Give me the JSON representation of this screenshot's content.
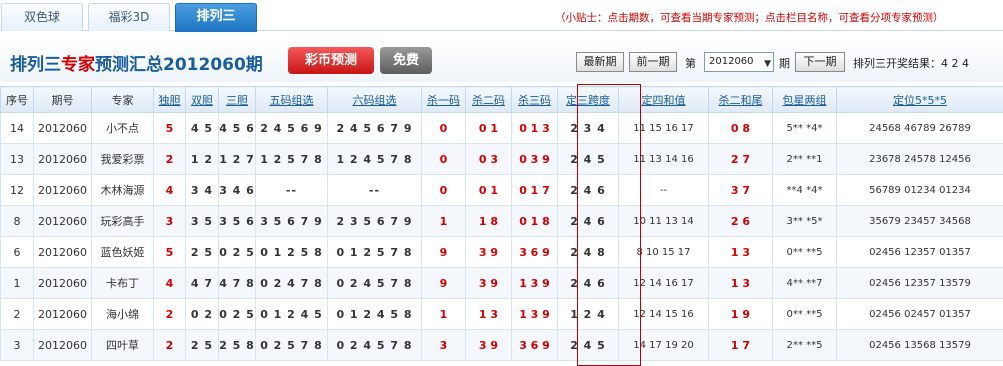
{
  "tabs": [
    {
      "label": "双色球"
    },
    {
      "label": "福彩3D"
    },
    {
      "label": "排列三"
    }
  ],
  "tip": "（小贴士：点击期数，可查看当期专家预测；点击栏目名称，可查看分项专家预测）",
  "header": {
    "title_a": "排列三",
    "title_b": "专家",
    "title_c": "预测汇总2012060期",
    "btn_predict": "彩币预测",
    "btn_free": "免费",
    "btn_latest": "最新期",
    "btn_prev": "前一期",
    "label_di": "第",
    "issue_value": "2012060",
    "label_qi": "期",
    "btn_next": "下一期",
    "result_label": "排列三开奖结果：",
    "result_value": "4 2 4"
  },
  "columns": [
    "序号",
    "期号",
    "专家",
    "独胆",
    "双胆",
    "三胆",
    "五码组选",
    "六码组选",
    "杀一码",
    "杀二码",
    "杀三码",
    "定三跨度",
    "定四和值",
    "杀二和尾",
    "包星两组",
    "定位5*5*5"
  ],
  "rows": [
    {
      "seq": "14",
      "issue": "2012060",
      "expert": "小不点",
      "c1": "5",
      "c2": "4 5",
      "c3": "4 5 6",
      "c4": "2 4 5 6 9",
      "c5": "2 4 5 6 7 9",
      "k1": "0",
      "k2": "0 1",
      "k3": "0 1 3",
      "span": "2 3 4",
      "sum4": "11 15 16 17",
      "kill2tail": "0 8",
      "star": "5** *4*",
      "pos": "24568 46789 26789"
    },
    {
      "seq": "13",
      "issue": "2012060",
      "expert": "我爱彩票",
      "c1": "2",
      "c2": "1 2",
      "c3": "1 2 7",
      "c4": "1 2 5 7 8",
      "c5": "1 2 4 5 7 8",
      "k1": "0",
      "k2": "0 3",
      "k3": "0 3 9",
      "span": "2 4 5",
      "sum4": "11 13 14 16",
      "kill2tail": "2 7",
      "star": "2** **1",
      "pos": "23678 24578 12456"
    },
    {
      "seq": "12",
      "issue": "2012060",
      "expert": "木林海源",
      "c1": "4",
      "c2": "3 4",
      "c3": "3 4 6",
      "c4": "--",
      "c5": "--",
      "k1": "0",
      "k2": "0 1",
      "k3": "0 1 7",
      "span": "2 4 6",
      "sum4": "--",
      "kill2tail": "3 7",
      "star": "**4 *4*",
      "pos": "56789 01234 01234"
    },
    {
      "seq": "8",
      "issue": "2012060",
      "expert": "玩彩高手",
      "c1": "3",
      "c2": "3 5",
      "c3": "3 5 6",
      "c4": "3 5 6 7 9",
      "c5": "2 3 5 6 7 9",
      "k1": "1",
      "k2": "1 8",
      "k3": "0 1 8",
      "span": "2 4 6",
      "sum4": "10 11 13 14",
      "kill2tail": "2 6",
      "star": "3** *5*",
      "pos": "35679 23457 34568"
    },
    {
      "seq": "6",
      "issue": "2012060",
      "expert": "蓝色妖姬",
      "c1": "5",
      "c2": "2 5",
      "c3": "0 2 5",
      "c4": "0 1 2 5 8",
      "c5": "0 1 2 5 7 8",
      "k1": "9",
      "k2": "3 9",
      "k3": "3 6 9",
      "span": "2 4 8",
      "sum4": "8 10 15 17",
      "kill2tail": "1 3",
      "star": "0** **5",
      "pos": "02456 12357 01357"
    },
    {
      "seq": "1",
      "issue": "2012060",
      "expert": "卡布丁",
      "c1": "4",
      "c2": "4 7",
      "c3": "4 7 8",
      "c4": "0 2 4 7 8",
      "c5": "0 2 4 5 7 8",
      "k1": "9",
      "k2": "3 9",
      "k3": "1 3 9",
      "span": "2 4 6",
      "sum4": "12 14 16 17",
      "kill2tail": "1 3",
      "star": "4** **7",
      "pos": "02456 12357 13579"
    },
    {
      "seq": "2",
      "issue": "2012060",
      "expert": "海小绵",
      "c1": "2",
      "c2": "0 2",
      "c3": "0 2 5",
      "c4": "0 1 2 4 5",
      "c5": "0 1 2 4 5 8",
      "k1": "1",
      "k2": "1 3",
      "k3": "1 3 9",
      "span": "1 2 4",
      "sum4": "12 14 15 16",
      "kill2tail": "1 9",
      "star": "0** **5",
      "pos": "02456 02457 01357"
    },
    {
      "seq": "3",
      "issue": "2012060",
      "expert": "四叶草",
      "c1": "2",
      "c2": "2 5",
      "c3": "2 5 8",
      "c4": "0 2 5 7 8",
      "c5": "0 2 4 5 7 8",
      "k1": "3",
      "k2": "3 9",
      "k3": "3 6 9",
      "span": "2 4 5",
      "sum4": "14 17 19 20",
      "kill2tail": "1 7",
      "star": "2** **5",
      "pos": "02456 13568 13579"
    }
  ]
}
